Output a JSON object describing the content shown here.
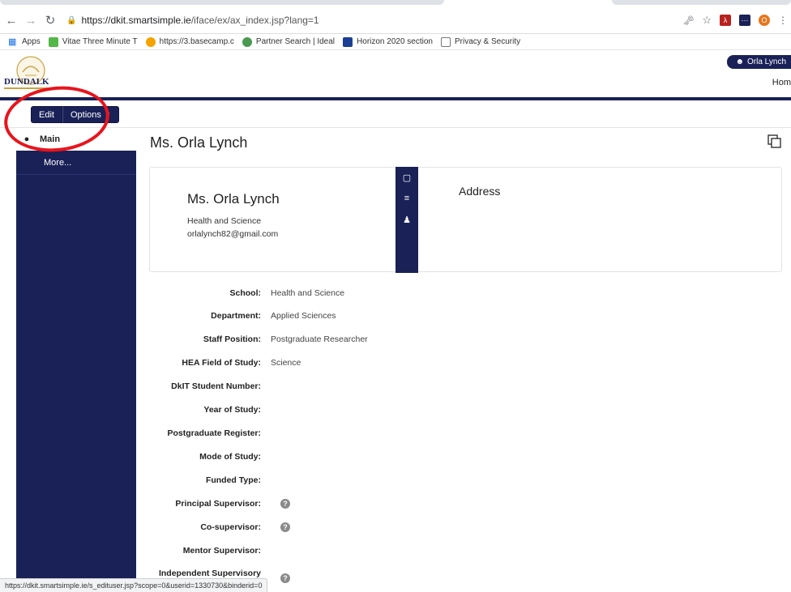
{
  "browser": {
    "url_host": "https://dkit.smartsimple.ie",
    "url_path": "/iface/ex/ax_index.jsp?lang=1",
    "back_icon": "arrow-left-icon",
    "forward_icon": "arrow-right-icon",
    "reload_icon": "reload-icon",
    "profile_initial": "O",
    "bookmarks": [
      {
        "label": "Apps",
        "color": "#1a73e8"
      },
      {
        "label": "Vitae Three Minute T",
        "color": "#53b848"
      },
      {
        "label": "https://3.basecamp.c",
        "color": "#f4a300"
      },
      {
        "label": "Partner Search | Ideal",
        "color": "#4a9a52"
      },
      {
        "label": "Horizon 2020 section",
        "color": "#1c3f94"
      },
      {
        "label": "Privacy & Security",
        "color": "#777777"
      }
    ],
    "status_url": "https://dkit.smartsimple.ie/s_edituser.jsp?scope=0&userid=1330730&binderid=0"
  },
  "header": {
    "logo_text": "DUNDALK",
    "user_name": "Orla Lynch",
    "home_label": "Hom"
  },
  "toolbar": {
    "edit_label": "Edit",
    "options_label": "Options"
  },
  "sidebar": {
    "items": [
      {
        "label": "Main"
      },
      {
        "label": "More..."
      }
    ]
  },
  "main": {
    "title": "Ms. Orla Lynch",
    "card": {
      "name": "Ms. Orla Lynch",
      "department": "Health and Science",
      "email": "orlalynch82@gmail.com",
      "address_title": "Address"
    },
    "fields": [
      {
        "label": "School:",
        "value": "Health and Science"
      },
      {
        "label": "Department:",
        "value": "Applied Sciences"
      },
      {
        "label": "Staff Position:",
        "value": "Postgraduate Researcher"
      },
      {
        "label": "HEA Field of Study:",
        "value": "Science"
      },
      {
        "label": "DkIT Student Number:",
        "value": ""
      },
      {
        "label": "Year of Study:",
        "value": ""
      },
      {
        "label": "Postgraduate Register:",
        "value": ""
      },
      {
        "label": "Mode of Study:",
        "value": ""
      },
      {
        "label": "Funded Type:",
        "value": ""
      },
      {
        "label": "Principal Supervisor:",
        "value": "",
        "help": "?"
      },
      {
        "label": "Co-supervisor:",
        "value": "",
        "help": "?"
      },
      {
        "label": "Mentor Supervisor:",
        "value": ""
      },
      {
        "label": "Independent Supervisory",
        "value": "",
        "help": "?"
      }
    ]
  },
  "colors": {
    "navy": "#1a2157",
    "annotation_red": "#e8141c"
  }
}
